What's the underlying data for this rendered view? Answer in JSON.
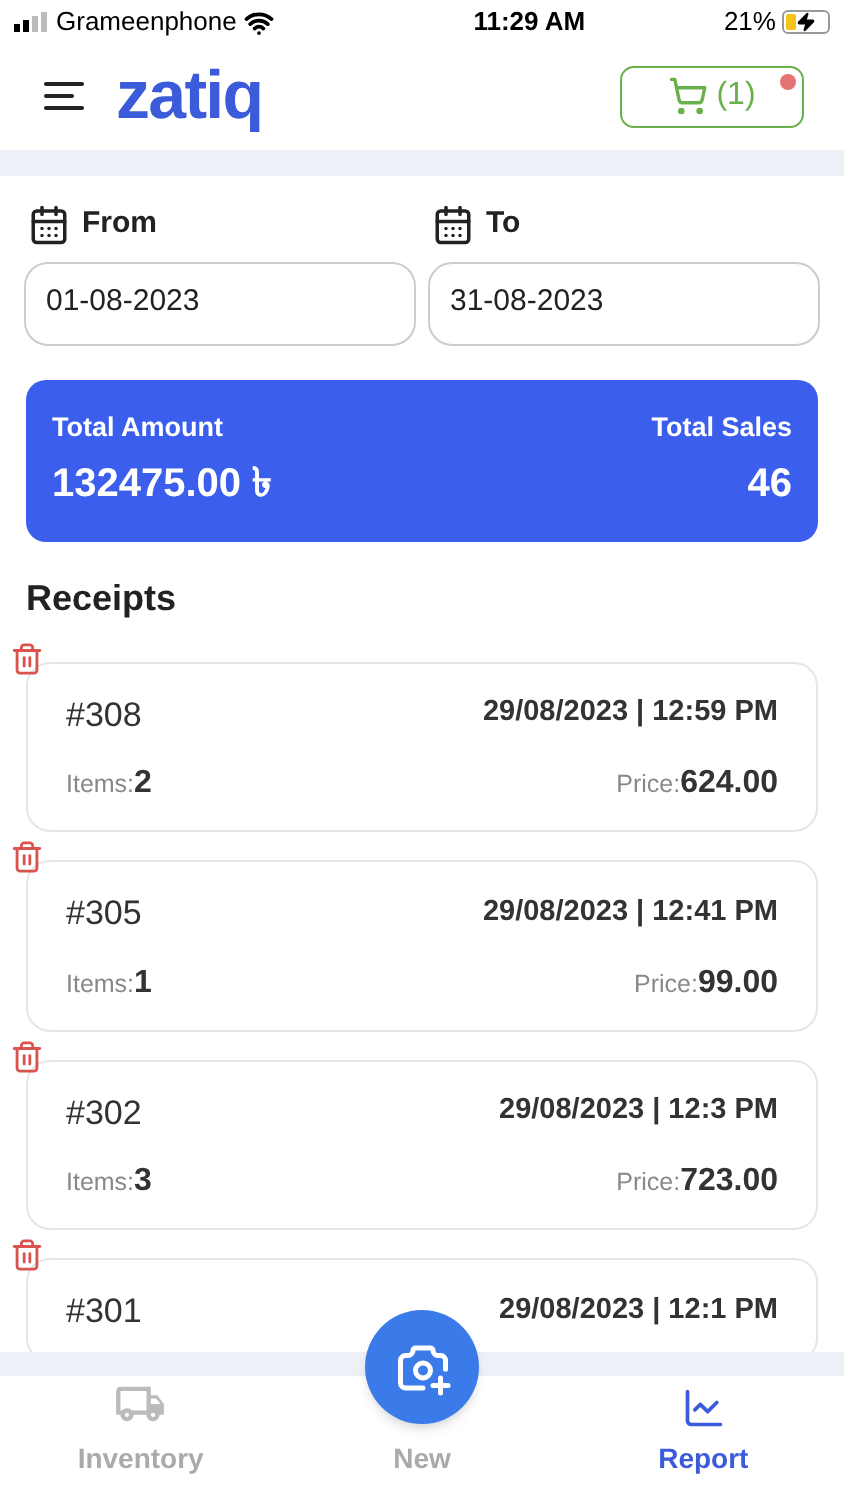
{
  "status_bar": {
    "carrier": "Grameenphone",
    "time": "11:29 AM",
    "battery": "21%"
  },
  "header": {
    "logo": "zatiq",
    "cart": {
      "count": "(1)",
      "has_dot": true
    }
  },
  "date_range": {
    "from": {
      "label": "From",
      "value": "01-08-2023"
    },
    "to": {
      "label": "To",
      "value": "31-08-2023"
    }
  },
  "summary": {
    "amount_label": "Total Amount",
    "amount": "132475.00 ৳",
    "sales_label": "Total Sales",
    "sales": "46"
  },
  "receipts_title": "Receipts",
  "receipts": [
    {
      "number": "#308",
      "datetime": "29/08/2023 | 12:59 PM",
      "items_label": "Items:",
      "items": "2",
      "price_label": "Price:",
      "price": "624.00"
    },
    {
      "number": "#305",
      "datetime": "29/08/2023 | 12:41 PM",
      "items_label": "Items:",
      "items": "1",
      "price_label": "Price:",
      "price": "99.00"
    },
    {
      "number": "#302",
      "datetime": "29/08/2023 | 12:3 PM",
      "items_label": "Items:",
      "items": "3",
      "price_label": "Price:",
      "price": "723.00"
    },
    {
      "number": "#301",
      "datetime": "29/08/2023 | 12:1 PM"
    }
  ],
  "bottom_nav": [
    {
      "kind": "inventory",
      "label": "Inventory",
      "selected": false
    },
    {
      "kind": "new",
      "label": "New",
      "selected": false
    },
    {
      "kind": "report",
      "label": "Report",
      "selected": true
    }
  ]
}
